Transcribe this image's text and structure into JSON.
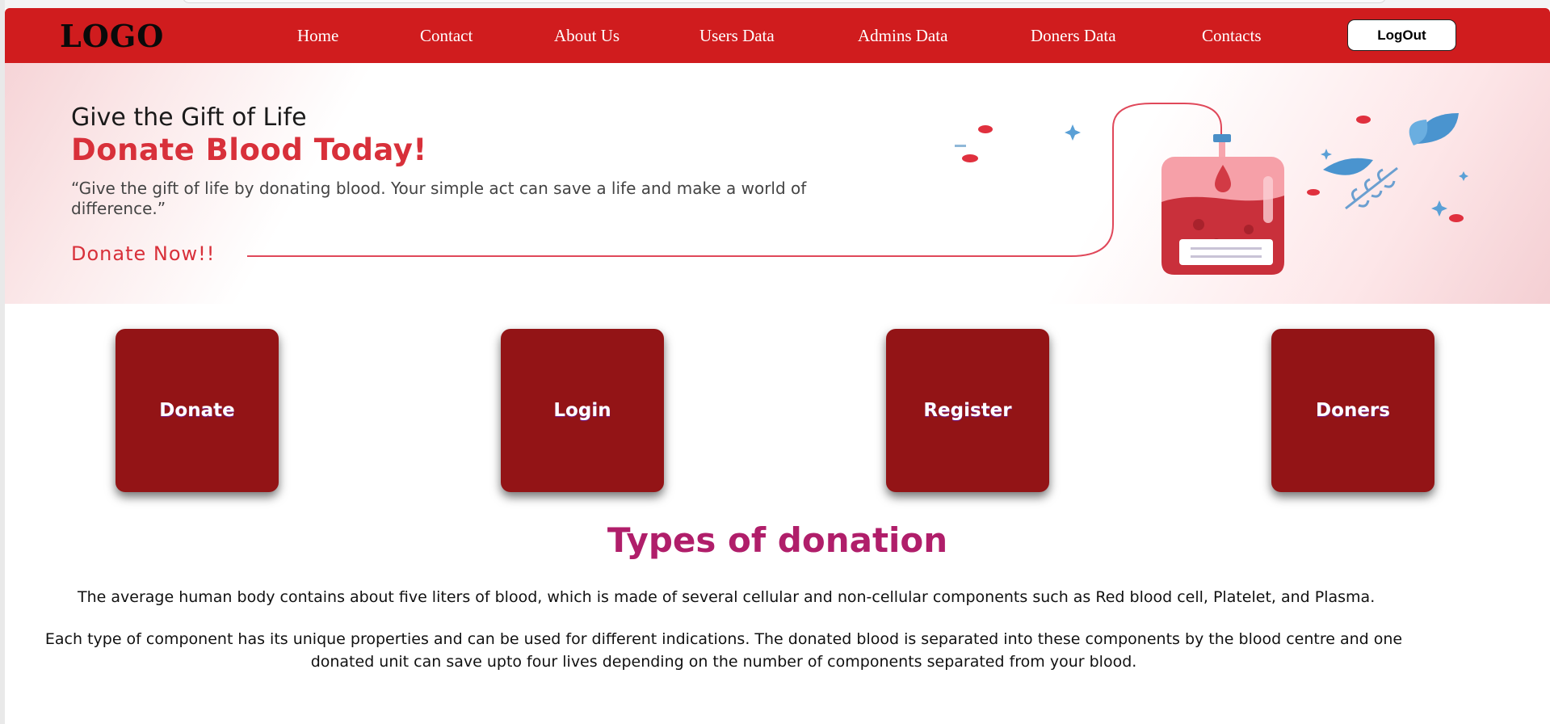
{
  "navbar": {
    "logo": "LOGO",
    "links": [
      "Home",
      "Contact",
      "About Us",
      "Users Data",
      "Admins Data",
      "Doners Data",
      "Contacts"
    ],
    "logout_label": "LogOut",
    "bg_color": "#d01c1e"
  },
  "hero": {
    "line1": "Give the Gift of Life",
    "line2": "Donate Blood Today!",
    "quote": "“Give the gift of life by donating blood. Your simple act can save a life and make a world of difference.”",
    "cta": "Donate Now!!",
    "accent_color": "#d8303a"
  },
  "cards": [
    {
      "label": "Donate"
    },
    {
      "label": "Login"
    },
    {
      "label": "Register"
    },
    {
      "label": "Doners"
    }
  ],
  "content": {
    "title": "Types of donation",
    "paragraph1": "The average human body contains about five liters of blood, which is made of several cellular and non-cellular components such as Red blood cell, Platelet, and Plasma.",
    "paragraph2": "Each type of component has its unique properties and can be used for different indications. The donated blood is separated into these components by the blood centre and one donated unit can save upto four lives depending on the number of components separated from your blood."
  },
  "icons": [
    "blood-bag-icon",
    "leaf-icon",
    "sparkle-icon"
  ]
}
